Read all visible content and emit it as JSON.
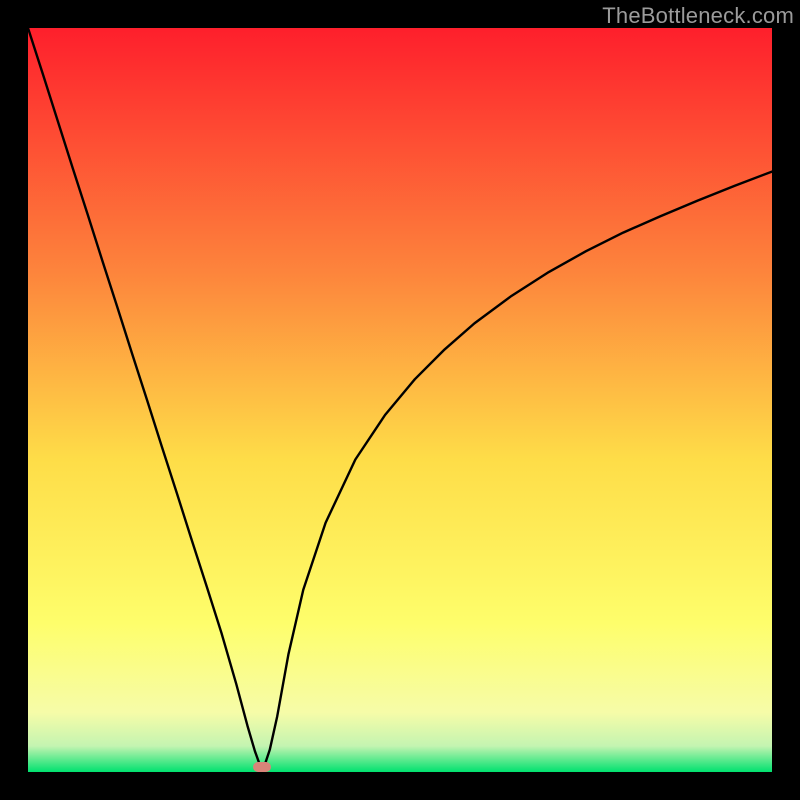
{
  "watermark": "TheBottleneck.com",
  "colors": {
    "gradient_top": "#fe1f2c",
    "gradient_upper_mid": "#fd853c",
    "gradient_mid": "#fedd48",
    "gradient_lower_mid": "#fefe6b",
    "gradient_low": "#f6fca8",
    "gradient_band": "#c4f4b1",
    "gradient_bottom": "#00e16f",
    "curve": "#000000",
    "marker": "#d98479",
    "frame": "#000000"
  },
  "chart_data": {
    "type": "line",
    "title": "",
    "xlabel": "",
    "ylabel": "",
    "xlim": [
      0,
      1
    ],
    "ylim": [
      0,
      1
    ],
    "notch_x": 0.315,
    "marker": {
      "x": 0.315,
      "y": 0.0
    },
    "series": [
      {
        "name": "bottleneck-curve",
        "x": [
          0.0,
          0.02,
          0.04,
          0.06,
          0.08,
          0.1,
          0.12,
          0.14,
          0.16,
          0.18,
          0.2,
          0.22,
          0.24,
          0.26,
          0.28,
          0.295,
          0.305,
          0.315,
          0.325,
          0.335,
          0.35,
          0.37,
          0.4,
          0.44,
          0.48,
          0.52,
          0.56,
          0.6,
          0.65,
          0.7,
          0.75,
          0.8,
          0.85,
          0.9,
          0.95,
          1.0
        ],
        "y": [
          1.0,
          0.938,
          0.875,
          0.812,
          0.75,
          0.687,
          0.625,
          0.562,
          0.5,
          0.437,
          0.375,
          0.312,
          0.25,
          0.187,
          0.118,
          0.062,
          0.028,
          0.0,
          0.03,
          0.075,
          0.158,
          0.245,
          0.335,
          0.42,
          0.48,
          0.528,
          0.568,
          0.603,
          0.64,
          0.672,
          0.7,
          0.725,
          0.747,
          0.768,
          0.788,
          0.807
        ]
      }
    ],
    "gradient_stops": [
      {
        "pos": 0.0,
        "color": "#fe1f2c"
      },
      {
        "pos": 0.33,
        "color": "#fd853c"
      },
      {
        "pos": 0.58,
        "color": "#fedd48"
      },
      {
        "pos": 0.8,
        "color": "#fefe6b"
      },
      {
        "pos": 0.92,
        "color": "#f6fca8"
      },
      {
        "pos": 0.965,
        "color": "#c4f4b1"
      },
      {
        "pos": 1.0,
        "color": "#00e16f"
      }
    ]
  }
}
